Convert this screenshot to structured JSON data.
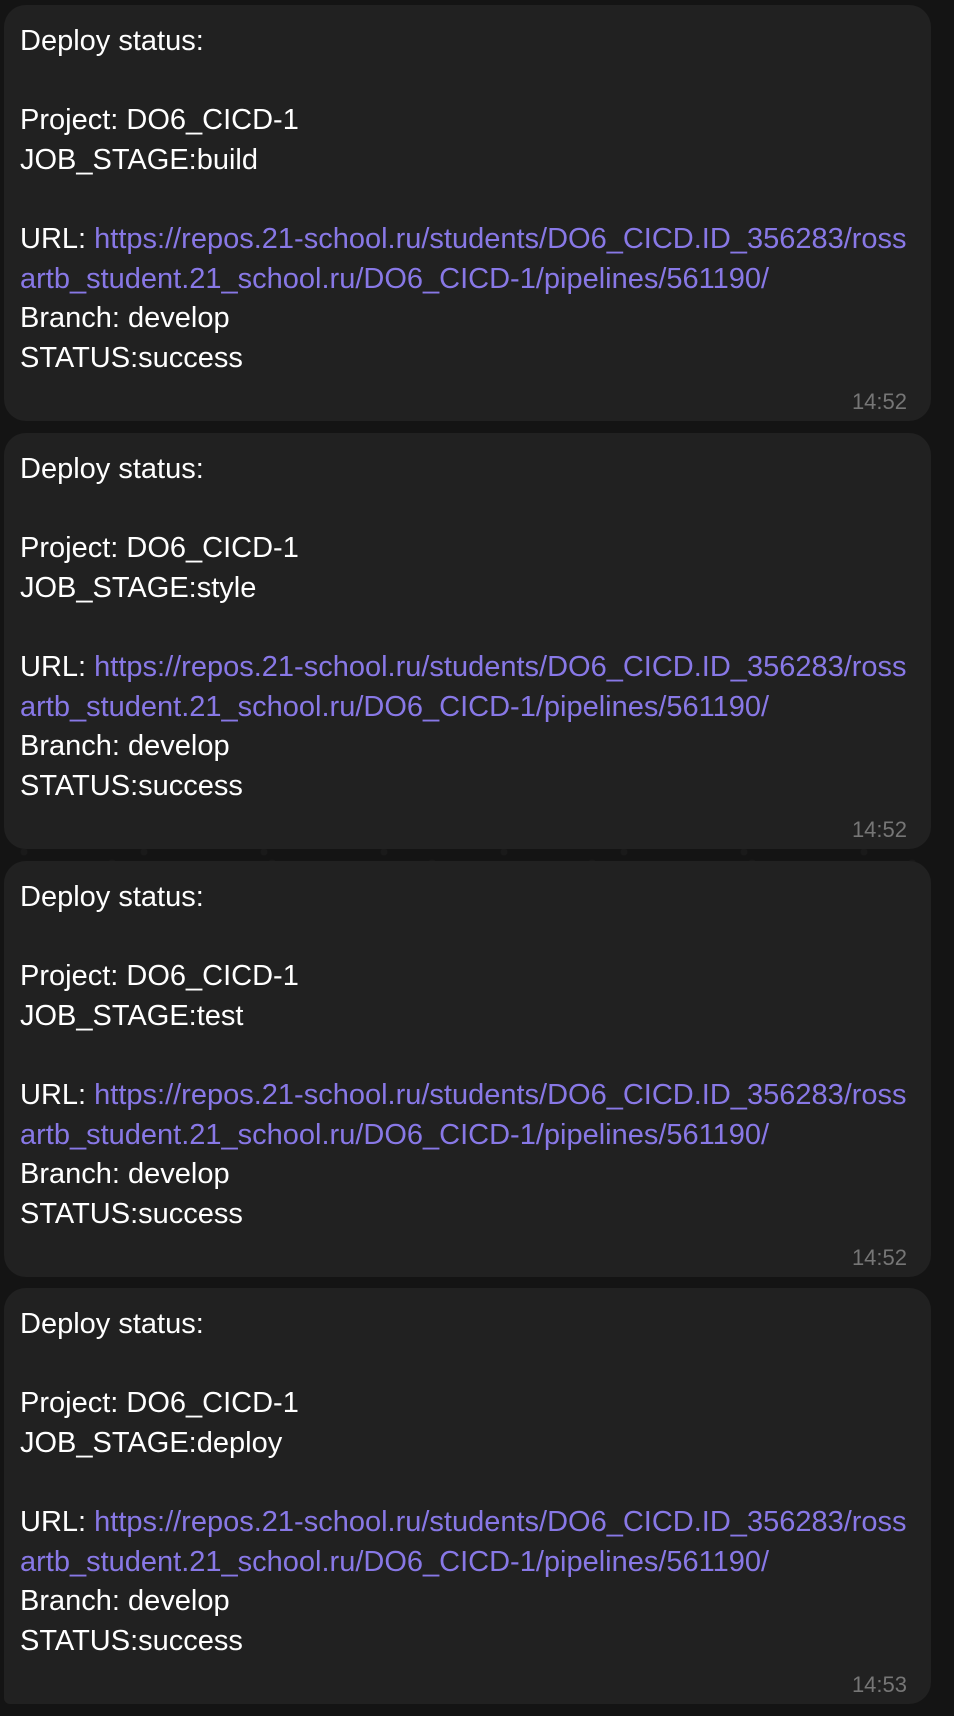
{
  "messages": [
    {
      "header": "Deploy status:",
      "project_label": "Project:",
      "project": "DO6_CICD-1",
      "stage_label": "JOB_STAGE:",
      "stage": "build",
      "url_label": "URL:",
      "url": "https://repos.21-school.ru/students/DO6_CICD.ID_356283/rossartb_student.21_school.ru/DO6_CICD-1/pipelines/561190/",
      "branch_label": "Branch:",
      "branch": "develop",
      "status_label": "STATUS:",
      "status": "success",
      "time": "14:52"
    },
    {
      "header": "Deploy status:",
      "project_label": "Project:",
      "project": "DO6_CICD-1",
      "stage_label": "JOB_STAGE:",
      "stage": "style",
      "url_label": "URL:",
      "url": "https://repos.21-school.ru/students/DO6_CICD.ID_356283/rossartb_student.21_school.ru/DO6_CICD-1/pipelines/561190/",
      "branch_label": "Branch:",
      "branch": "develop",
      "status_label": "STATUS:",
      "status": "success",
      "time": "14:52"
    },
    {
      "header": "Deploy status:",
      "project_label": "Project:",
      "project": "DO6_CICD-1",
      "stage_label": "JOB_STAGE:",
      "stage": "test",
      "url_label": "URL:",
      "url": "https://repos.21-school.ru/students/DO6_CICD.ID_356283/rossartb_student.21_school.ru/DO6_CICD-1/pipelines/561190/",
      "branch_label": "Branch:",
      "branch": "develop",
      "status_label": "STATUS:",
      "status": "success",
      "time": "14:52"
    },
    {
      "header": "Deploy status:",
      "project_label": "Project:",
      "project": "DO6_CICD-1",
      "stage_label": "JOB_STAGE:",
      "stage": "deploy",
      "url_label": "URL:",
      "url": "https://repos.21-school.ru/students/DO6_CICD.ID_356283/rossartb_student.21_school.ru/DO6_CICD-1/pipelines/561190/",
      "branch_label": "Branch:",
      "branch": "develop",
      "status_label": "STATUS:",
      "status": "success",
      "time": "14:53"
    }
  ],
  "colors": {
    "background": "#141414",
    "bubble": "#212121",
    "text": "#ffffff",
    "link": "#8878e6",
    "timestamp": "#767676"
  }
}
